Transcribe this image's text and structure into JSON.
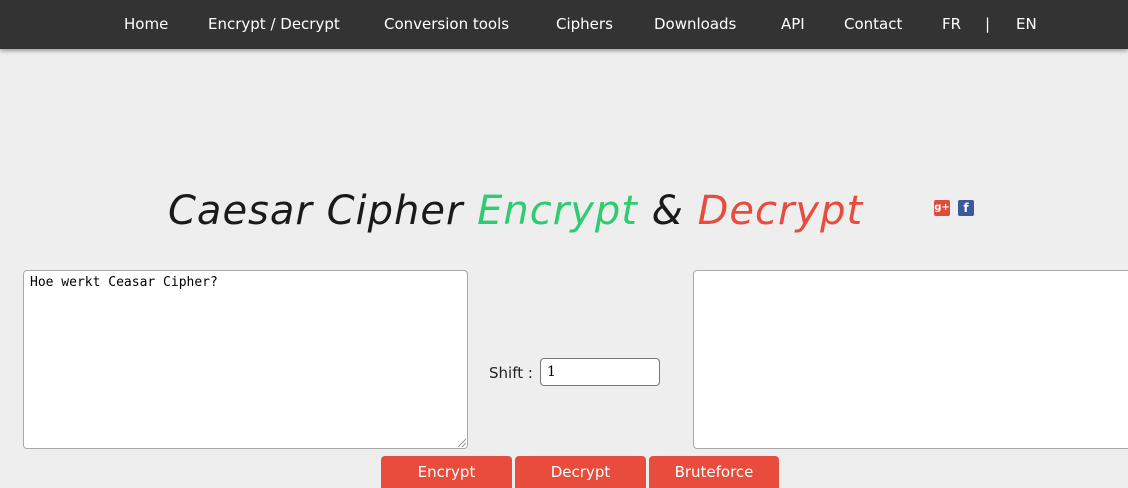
{
  "nav": {
    "home": "Home",
    "encrypt_decrypt": "Encrypt / Decrypt",
    "conversion_tools": "Conversion tools",
    "ciphers": "Ciphers",
    "downloads": "Downloads",
    "api": "API",
    "contact": "Contact",
    "lang_fr": "FR",
    "separator": "|",
    "lang_en": "EN"
  },
  "title": {
    "part1": "Caesar Cipher",
    "part2": "Encrypt",
    "part3": "&",
    "part4": "Decrypt"
  },
  "social": {
    "gplus_glyph": "g+",
    "facebook_glyph": "f"
  },
  "input_text": {
    "value": "Hoe werkt Ceasar Cipher?"
  },
  "output_text": {
    "value": ""
  },
  "shift": {
    "label": "Shift :",
    "value": "1"
  },
  "buttons": {
    "encrypt": "Encrypt",
    "decrypt": "Decrypt",
    "bruteforce": "Bruteforce"
  },
  "colors": {
    "navbar_bg": "#333333",
    "page_bg": "#eeeeee",
    "accent_red": "#e74c3c",
    "accent_green": "#2ecc71"
  }
}
